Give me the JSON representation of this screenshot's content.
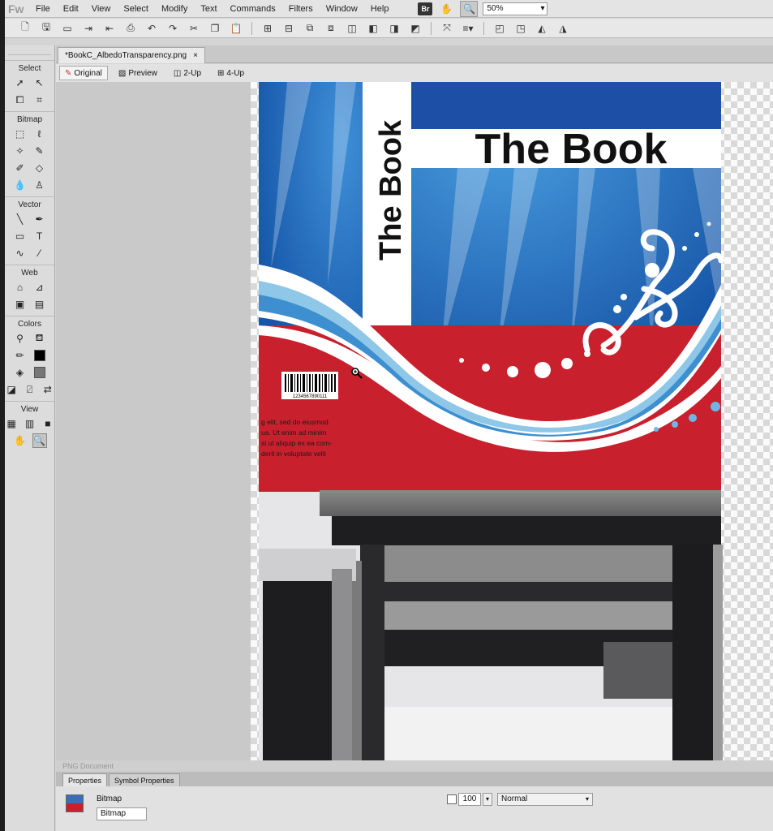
{
  "app": {
    "logo": "Fw"
  },
  "menu": [
    "File",
    "Edit",
    "View",
    "Select",
    "Modify",
    "Text",
    "Commands",
    "Filters",
    "Window",
    "Help"
  ],
  "top_right": {
    "bridge_label": "Br",
    "zoom_value": "50%"
  },
  "document": {
    "tab_name": "*BookC_AlbedoTransparency.png",
    "close": "×"
  },
  "view_modes": [
    "Original",
    "Preview",
    "2-Up",
    "4-Up"
  ],
  "tools": {
    "sections": [
      "Select",
      "Bitmap",
      "Vector",
      "Web",
      "Colors",
      "View"
    ]
  },
  "artwork": {
    "spine_title": "The Book",
    "cover_title": "The Book",
    "barcode_number": "1234567890111",
    "back_text": [
      "g elit, sed do eiusmod",
      "ua. Ut enim ad minim",
      "si ut aliquip ex ea com-",
      "derit in voluptate velit"
    ]
  },
  "status": {
    "doc_type": "PNG Document"
  },
  "properties": {
    "tabs": [
      "Properties",
      "Symbol Properties"
    ],
    "object_type": "Bitmap",
    "object_name": "Bitmap",
    "opacity": "100",
    "blend_mode": "Normal"
  },
  "colors": {
    "cover_blue": "#1f6fc0",
    "cover_red": "#c8202d",
    "desk_dark": "#1e1e20"
  }
}
